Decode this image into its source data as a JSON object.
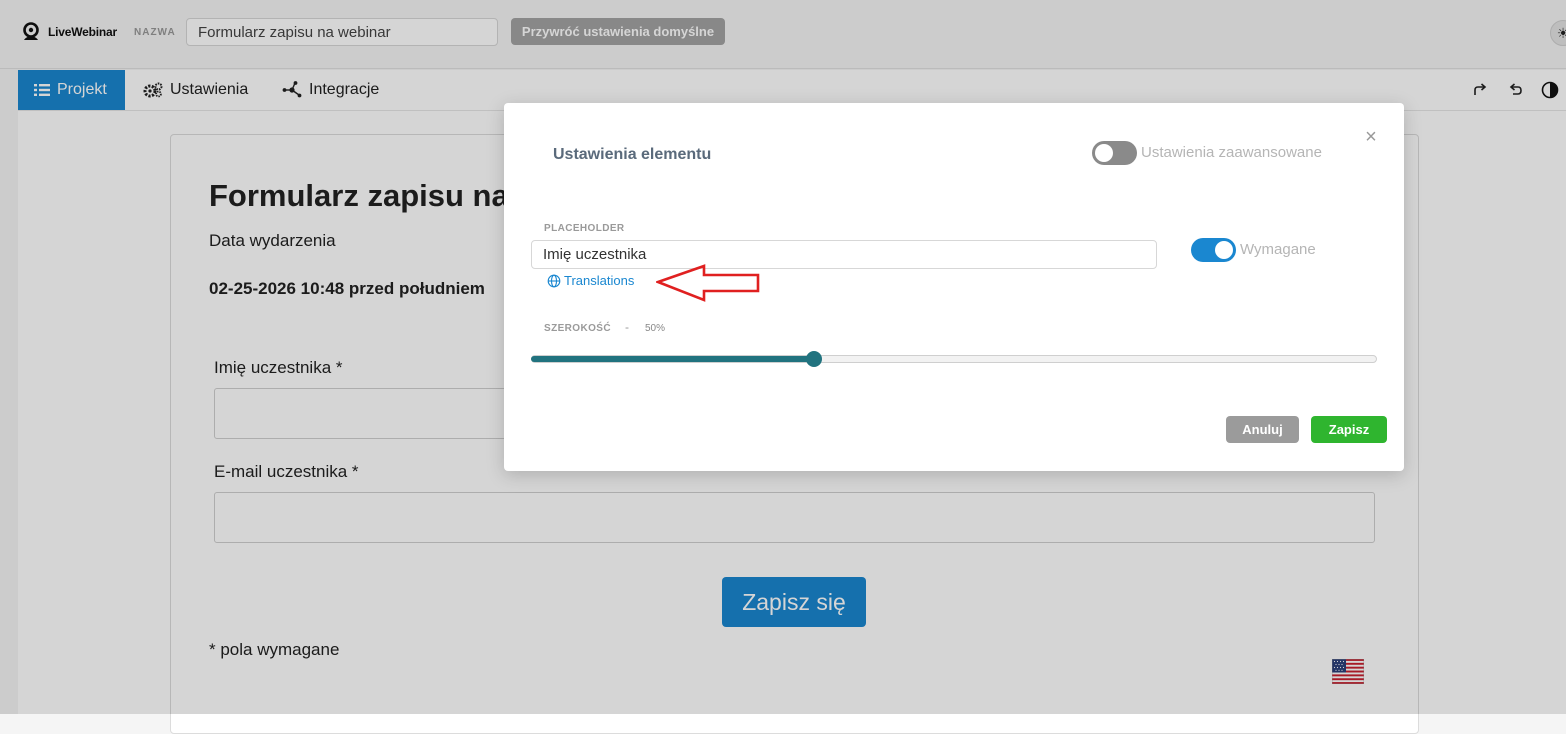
{
  "header": {
    "logo_text": "LiveWebinar",
    "name_label": "NAZWA",
    "name_value": "Formularz zapisu na webinar",
    "reset_button": "Przywróć ustawienia domyślne",
    "theme_icon": "sun-icon"
  },
  "tabs": [
    {
      "label": "Projekt",
      "icon": "list-icon",
      "active": true
    },
    {
      "label": "Ustawienia",
      "icon": "gears-icon",
      "active": false
    },
    {
      "label": "Integracje",
      "icon": "network-icon",
      "active": false
    }
  ],
  "toolbar": {
    "redo_icon": "redo-icon",
    "undo_icon": "undo-icon",
    "contrast_icon": "contrast-icon"
  },
  "form": {
    "title": "Formularz zapisu na webinar",
    "event_date_label": "Data wydarzenia",
    "event_date_value": "02-25-2026 10:48 przed południem",
    "fields": [
      {
        "label": "Imię uczestnika *"
      },
      {
        "label": "E-mail uczestnika *"
      }
    ],
    "submit_label": "Zapisz się",
    "required_note": "* pola wymagane",
    "language_icon": "us-flag-icon"
  },
  "dialog": {
    "title": "Ustawienia elementu",
    "advanced_label": "Ustawienia zaawansowane",
    "advanced_on": false,
    "placeholder_label": "PLACEHOLDER",
    "placeholder_value": "Imię uczestnika",
    "translations_link": "Translations",
    "required_label": "Wymagane",
    "required_on": true,
    "width_label": "SZEROKOŚĆ",
    "width_dash": "-",
    "width_value": "50%",
    "slider_fraction": 0.335,
    "cancel_label": "Anuluj",
    "save_label": "Zapisz",
    "annotation_color": "#e02020"
  }
}
